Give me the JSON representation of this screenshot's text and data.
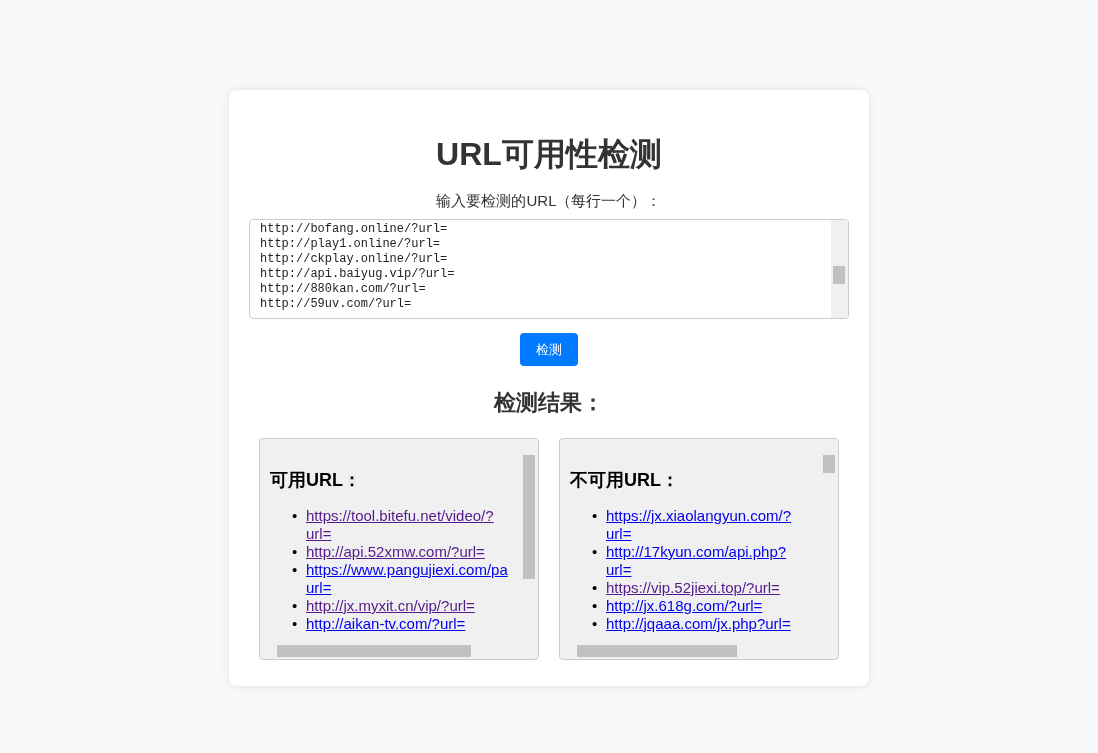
{
  "title": "URL可用性检测",
  "input": {
    "label": "输入要检测的URL（每行一个）：",
    "lines": [
      "http://bofang.online/?url=",
      "http://play1.online/?url=",
      "http://ckplay.online/?url=",
      "http://api.baiyug.vip/?url=",
      "http://880kan.com/?url=",
      "http://59uv.com/?url="
    ]
  },
  "bullet": "•",
  "check_button": "检测",
  "results_heading": "检测结果：",
  "panels": [
    {
      "heading": "可用URL：",
      "links": [
        {
          "lines": [
            "https://tool.bitefu.net/video/?",
            "url="
          ],
          "visited": true
        },
        {
          "lines": [
            "http://api.52xmw.com/?url="
          ],
          "visited": true
        },
        {
          "lines": [
            "https://www.pangujiexi.com/pa",
            "url="
          ],
          "visited": false
        },
        {
          "lines": [
            "http://jx.myxit.cn/vip/?url="
          ],
          "visited": true
        },
        {
          "lines": [
            "http://aikan-tv.com/?url="
          ],
          "visited": false
        }
      ]
    },
    {
      "heading": "不可用URL：",
      "links": [
        {
          "lines": [
            "https://jx.xiaolangyun.com/?",
            "url="
          ],
          "visited": false
        },
        {
          "lines": [
            "http://17kyun.com/api.php?",
            "url="
          ],
          "visited": false
        },
        {
          "lines": [
            "https://vip.52jiexi.top/?url="
          ],
          "visited": true
        },
        {
          "lines": [
            "http://jx.618g.com/?url="
          ],
          "visited": false
        },
        {
          "lines": [
            "http://jqaaa.com/jx.php?url="
          ],
          "visited": false
        }
      ]
    }
  ]
}
